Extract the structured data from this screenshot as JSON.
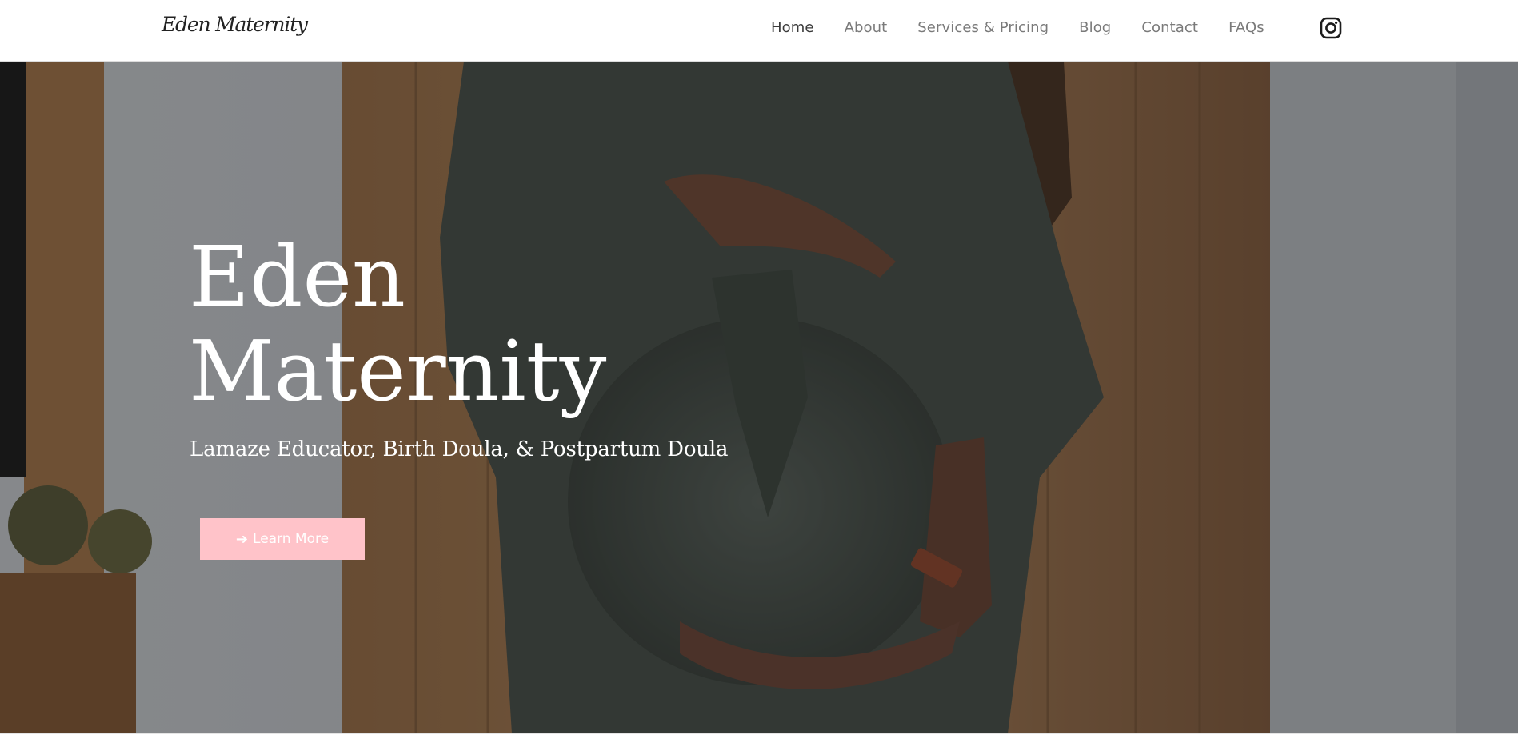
{
  "header": {
    "logo_text": "Eden Maternity",
    "nav": [
      {
        "label": "Home",
        "active": true
      },
      {
        "label": "About",
        "active": false
      },
      {
        "label": "Services & Pricing",
        "active": false
      },
      {
        "label": "Blog",
        "active": false
      },
      {
        "label": "Contact",
        "active": false
      },
      {
        "label": "FAQs",
        "active": false
      }
    ],
    "social_icon": "instagram-icon"
  },
  "hero": {
    "title_line1": "Eden",
    "title_line2": "Maternity",
    "subtitle": "Lamaze Educator, Birth Doula, & Postpartum Doula",
    "button_label": "Learn More",
    "button_icon": "arrow-right-icon",
    "button_color": "#ffc3c9",
    "image_subject": "pregnant-woman-photo"
  },
  "colors": {
    "nav_active": "#3a3a3a",
    "nav_inactive": "#7a7a7a",
    "accent_pink": "#ffc3c9"
  }
}
